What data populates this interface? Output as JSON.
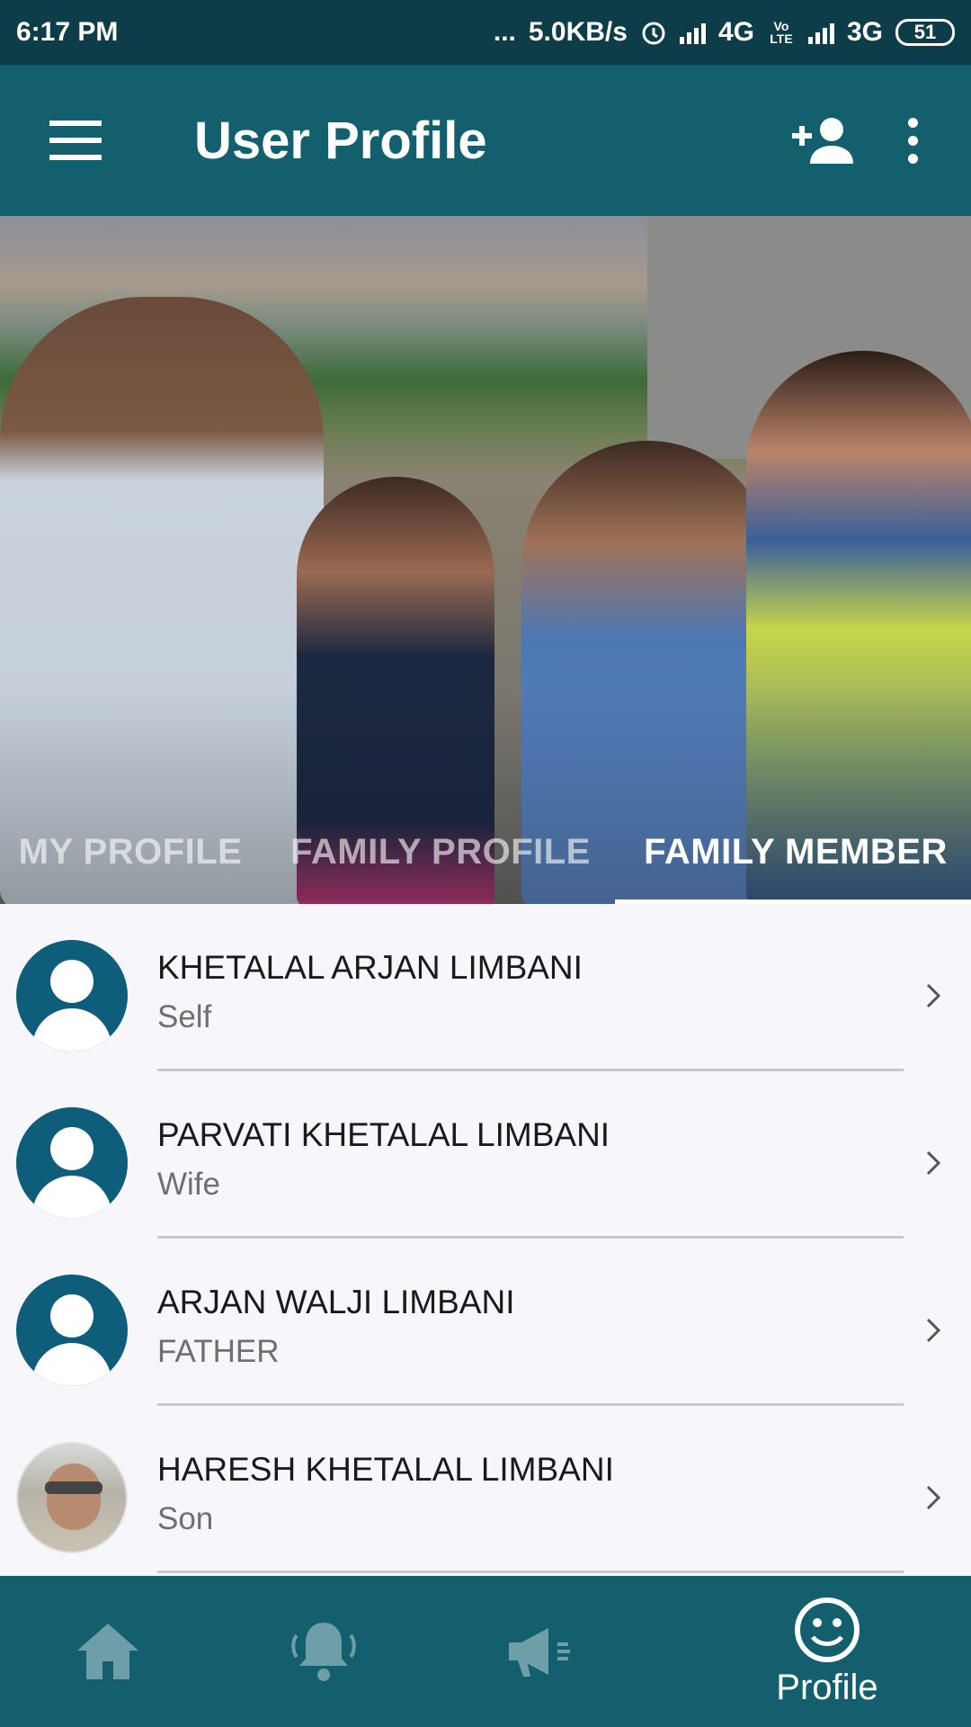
{
  "status_bar": {
    "time": "6:17 PM",
    "dots": "...",
    "speed": "5.0KB/s",
    "network1": "4G",
    "volte": "Vo LTE",
    "network2": "3G",
    "battery": "51"
  },
  "app_bar": {
    "title": "User Profile",
    "menu_icon": "hamburger-menu-icon",
    "add_icon": "add-person-icon",
    "more_icon": "more-vertical-icon"
  },
  "tabs": [
    {
      "label": "MY PROFILE",
      "active": false
    },
    {
      "label": "FAMILY PROFILE",
      "active": false
    },
    {
      "label": "FAMILY MEMBER",
      "active": true
    }
  ],
  "members": [
    {
      "name": "KHETALAL ARJAN LIMBANI",
      "relation": "Self",
      "avatar": "default-avatar-icon"
    },
    {
      "name": "PARVATI KHETALAL LIMBANI",
      "relation": "Wife",
      "avatar": "default-avatar-icon"
    },
    {
      "name": "ARJAN WALJI LIMBANI",
      "relation": "FATHER",
      "avatar": "default-avatar-icon"
    },
    {
      "name": "HARESH KHETALAL LIMBANI",
      "relation": "Son",
      "avatar": "photo-avatar"
    }
  ],
  "bottom_nav": {
    "items": [
      {
        "icon": "home-icon"
      },
      {
        "icon": "bell-icon"
      },
      {
        "icon": "megaphone-icon"
      },
      {
        "icon": "smiley-icon",
        "label": "Profile",
        "active": true
      }
    ]
  },
  "colors": {
    "status_bar": "#0e3d4a",
    "primary": "#145f6e",
    "avatar": "#0e5d7a",
    "list_bg": "#f7f6fa",
    "nav_inactive": "#6e9ea8"
  }
}
